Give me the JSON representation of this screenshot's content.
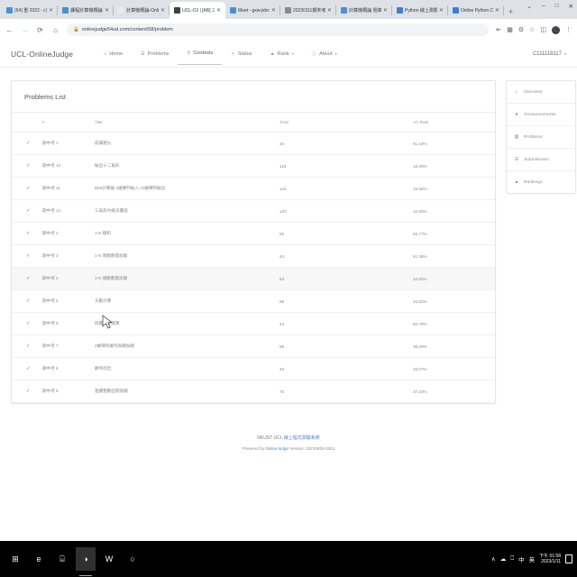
{
  "browser": {
    "tabs": [
      {
        "title": "(64) 重 2022 - c1111",
        "favicon_color": "#4a90d9",
        "icon_name": "mail-icon",
        "active": false
      },
      {
        "title": "課程計算機概論(三)",
        "favicon_color": "#4a90d9",
        "icon_name": "mail-icon",
        "active": false
      },
      {
        "title": "計算機概論-OnlineJud",
        "favicon_color": "#e8eaed",
        "icon_name": "page-icon",
        "active": false
      },
      {
        "title": "UCL-OJ | [AB] 三 三",
        "favicon_color": "#3c4043",
        "icon_name": "judge-icon",
        "active": true
      },
      {
        "title": "Meet - gxw-jxbc",
        "favicon_color": "#4a90d9",
        "icon_name": "meet-icon",
        "active": false
      },
      {
        "title": "20230111期末考(二)",
        "favicon_color": "#8a8a8a",
        "icon_name": "doc-icon",
        "active": false
      },
      {
        "title": "計算機概論 題庫",
        "favicon_color": "#4a90d9",
        "icon_name": "sheet-icon",
        "active": false
      },
      {
        "title": "Python 線上測驗題庫",
        "favicon_color": "#3c7fd1",
        "icon_name": "python-icon",
        "active": false
      },
      {
        "title": "Online Python Com",
        "favicon_color": "#3c7fd1",
        "icon_name": "python-icon",
        "active": false
      }
    ],
    "new_tab_label": "+",
    "window_controls": {
      "minimize": "–",
      "maximize": "□",
      "close": "✕",
      "extra": "⌄"
    },
    "nav": {
      "back": "←",
      "forward": "→",
      "reload": "⟳",
      "home": "⌂"
    },
    "url": "onlinejudge54ud.com/content/58/problem",
    "lock_icon": "lock-icon",
    "toolbar_icons": [
      "share-icon",
      "image-icon",
      "extension-icon",
      "star-icon",
      "reader-icon"
    ],
    "profile_initial": "C",
    "menu_icon": "⋮"
  },
  "header": {
    "brand": "UCL-OnlineJudge",
    "nav": [
      {
        "label": "Home",
        "icon": "home-icon",
        "active": false,
        "caret": false
      },
      {
        "label": "Problems",
        "icon": "list-icon",
        "active": false,
        "caret": false
      },
      {
        "label": "Contests",
        "icon": "trophy-icon",
        "active": true,
        "caret": false
      },
      {
        "label": "Status",
        "icon": "pulse-icon",
        "active": false,
        "caret": false
      },
      {
        "label": "Rank",
        "icon": "chart-icon",
        "active": false,
        "caret": true
      },
      {
        "label": "About",
        "icon": "info-icon",
        "active": false,
        "caret": true
      }
    ],
    "username": "C111118117",
    "user_caret": "▾"
  },
  "problems": {
    "card_title": "Problems List",
    "columns": [
      "#",
      "Title",
      "Total",
      "AC Rate"
    ],
    "rows": [
      {
        "status": "✓",
        "num": "期中考 1",
        "title": "成績劃分",
        "total": "34",
        "rate": "91.18%",
        "hover": false
      },
      {
        "status": "✓",
        "num": "期中考 10",
        "title": "輸出十二角形",
        "total": "115",
        "rate": "18.26%",
        "hover": false
      },
      {
        "status": "✓",
        "num": "期中考 11",
        "title": "BMI計算器-3維陣列輸入,10維陣列輸出",
        "total": "124",
        "rate": "18.55%",
        "hover": false
      },
      {
        "status": "✓",
        "num": "期中考 12",
        "title": "三角形內縮法畫弧",
        "total": "133",
        "rate": "18.80%",
        "hover": false
      },
      {
        "status": "✓",
        "num": "期中考 2",
        "title": "1-N 總和",
        "total": "62",
        "rate": "46.77%",
        "hover": false
      },
      {
        "status": "✓",
        "num": "期中考 3",
        "title": "1-N 偶數數量加總",
        "total": "44",
        "rate": "61.36%",
        "hover": false
      },
      {
        "status": "✓",
        "num": "期中考 4",
        "title": "1-N 偶數數量加總",
        "total": "63",
        "rate": "34.62%",
        "hover": true
      },
      {
        "status": "✓",
        "num": "期中考 5",
        "title": "天數計算",
        "total": "68",
        "rate": "33.82%",
        "hover": false
      },
      {
        "status": "✓",
        "num": "期中考 6",
        "title": "倒置加法運算",
        "total": "43",
        "rate": "62.79%",
        "hover": false
      },
      {
        "status": "✓",
        "num": "期中考 7",
        "title": "2維陣列維列與欄加總",
        "total": "56",
        "rate": "39.29%",
        "hover": false
      },
      {
        "status": "✓",
        "num": "期中考 8",
        "title": "數列印出",
        "total": "42",
        "rate": "28.57%",
        "hover": false
      },
      {
        "status": "✓",
        "num": "期中考 9",
        "title": "連續整數區間加總",
        "total": "75",
        "rate": "37.33%",
        "hover": false
      }
    ]
  },
  "sidebar": {
    "items": [
      {
        "label": "Overview",
        "icon": "home-icon"
      },
      {
        "label": "Announcements",
        "icon": "bell-icon"
      },
      {
        "label": "Problems",
        "icon": "book-icon"
      },
      {
        "label": "Submissions",
        "icon": "list-icon"
      },
      {
        "label": "Rankings",
        "icon": "chart-icon"
      }
    ]
  },
  "footer": {
    "line1_prefix": "NKUST UCL ",
    "line1_link": "線上程式測驗系統",
    "line2_prefix": "Powered by ",
    "line2_link": "OnlineJudge",
    "line2_suffix": "  Version: 20220928-0301"
  },
  "taskbar": {
    "start_icon": "windows-icon",
    "items": [
      {
        "icon": "edge-icon",
        "glyph": "e",
        "active": false
      },
      {
        "icon": "explorer-icon",
        "glyph": "⌸",
        "active": false
      },
      {
        "icon": "chrome-icon",
        "glyph": "◑",
        "active": true
      },
      {
        "icon": "word-icon",
        "glyph": "W",
        "active": false
      },
      {
        "icon": "app-icon",
        "glyph": "○",
        "active": false
      }
    ],
    "tray": {
      "chevron": "∧",
      "icons": [
        "cloud-icon",
        "screen-icon",
        "ime-icon",
        "lang-icon"
      ],
      "time": "下午 01:58",
      "date": "2023/1/11",
      "notification_icon": "notification-icon"
    }
  }
}
